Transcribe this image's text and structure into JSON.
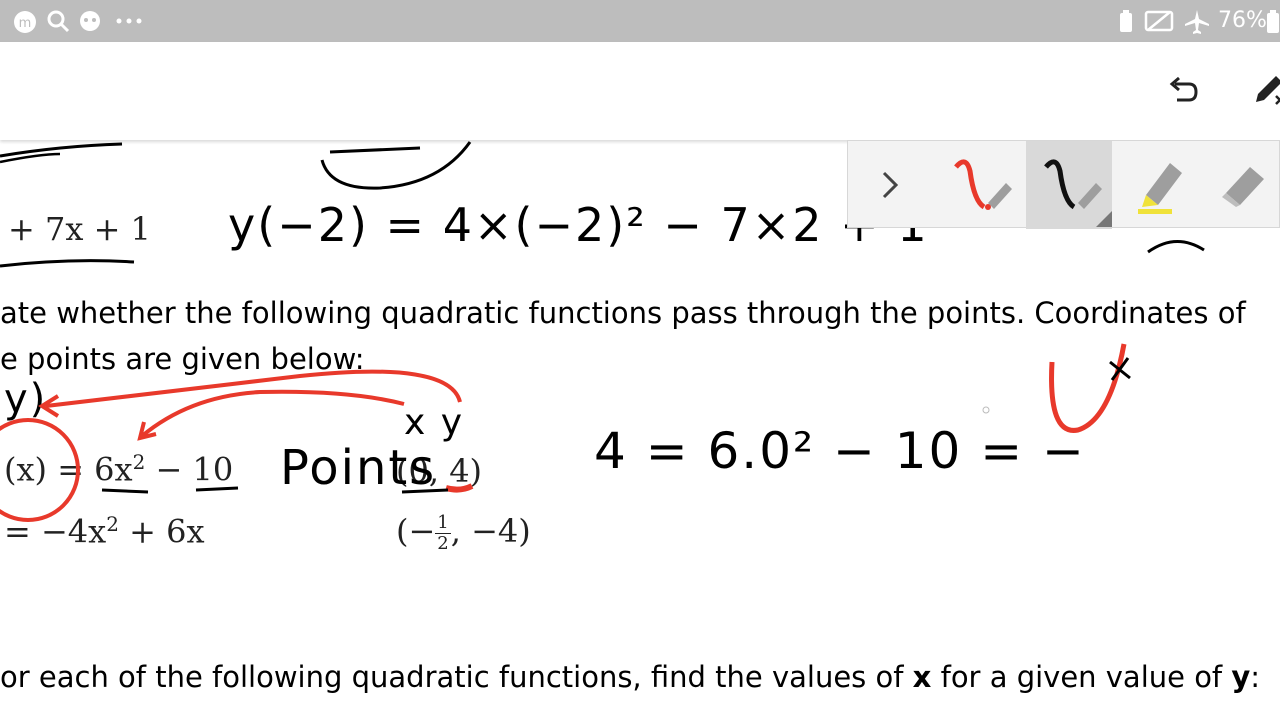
{
  "status_bar": {
    "battery_percent": "76%",
    "icons": [
      "m-app-icon",
      "search-icon",
      "bug-icon",
      "more-icon",
      "battery-saver-icon",
      "cast-icon",
      "airplane-icon",
      "battery-icon"
    ]
  },
  "toolbar": {
    "icons": [
      "undo-icon",
      "pen-edit-icon"
    ]
  },
  "palette": {
    "tools": [
      "expand-chevron-icon",
      "red-pen-icon",
      "black-pen-icon",
      "highlighter-icon",
      "eraser-icon"
    ],
    "colors": {
      "red": "#e8392b",
      "black": "#111111",
      "highlighter": "#f0e23a",
      "selected_bg": "#d9d9d9"
    }
  },
  "document": {
    "top_expression": "+ 7x + 1",
    "question_line1": "ate whether the following quadratic functions pass through the points. Coordinates of",
    "question_line2": "e points are given below:",
    "func1_prefix": "(x) = 6x",
    "func1_exp": "2",
    "func1_suffix": " − 10",
    "func2_prefix": "= −4x",
    "func2_exp": "2",
    "func2_suffix": " + 6x",
    "point1": "(0, 4)",
    "point2_prefix": "(−",
    "point2_num": "1",
    "point2_den": "2",
    "point2_suffix": ", −4)",
    "question2_prefix": "or each of the following quadratic functions, find the values of ",
    "question2_x": "x",
    "question2_mid": " for a given value of ",
    "question2_y": "y",
    "question2_end": ":"
  },
  "handwriting": {
    "eq_top": "y(−2) = 4×(−2)² − 7×2 + 1",
    "label_y": "y)",
    "label_points": "Points",
    "label_xy": "x  y",
    "eq_mid": "4 = 6.0² − 10 = −"
  }
}
